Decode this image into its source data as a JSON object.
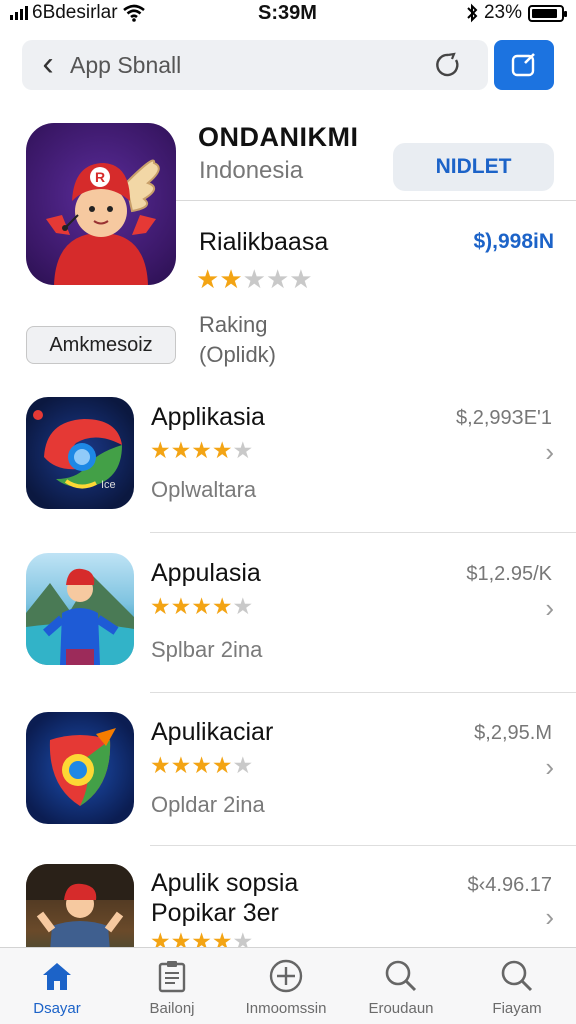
{
  "status_bar": {
    "carrier": "6Bdesirlar",
    "time": "S:39M",
    "battery": "23%",
    "battery_level": 0.9
  },
  "search": {
    "text": "App Sbnall"
  },
  "featured": {
    "title": "ONDANIKMI",
    "subtitle": "Indonesia",
    "get_label": "NIDLET",
    "sub_name": "Rialikbaasa",
    "sub_price": "$),998iΝ",
    "rating": 2,
    "ranking_line1": "Raking",
    "ranking_line2": "(Oplidk)",
    "pill_label": "Amkmesoiz"
  },
  "apps": [
    {
      "name": "Applikasia",
      "price": "$,2,99ЗЕ'1",
      "subline": "Oplwaltara",
      "rating": 4,
      "icon_caption": "Ice"
    },
    {
      "name": "Appulasia",
      "price": "$1,2.95/K",
      "subline": "Splbar 2ina",
      "rating": 4
    },
    {
      "name": "Apulikaciar",
      "price": "$,2,95.M",
      "subline": "Opldar 2ina",
      "rating": 4
    },
    {
      "name": "Apulik sopsia",
      "name_line2": "Popikar 3er",
      "price": "$‹4.96.17",
      "rating": 4
    }
  ],
  "tabs": [
    {
      "label": "Dsayar",
      "icon": "home-icon",
      "active": true
    },
    {
      "label": "Bailonj",
      "icon": "clipboard-icon"
    },
    {
      "label": "Inmoomssin",
      "icon": "plus-circle-icon"
    },
    {
      "label": "Eroudaun",
      "icon": "search-icon"
    },
    {
      "label": "Fiayam",
      "icon": "search-icon"
    }
  ],
  "colors": {
    "accent": "#1c73e0",
    "link": "#1c63c8",
    "star": "#f3a414"
  }
}
